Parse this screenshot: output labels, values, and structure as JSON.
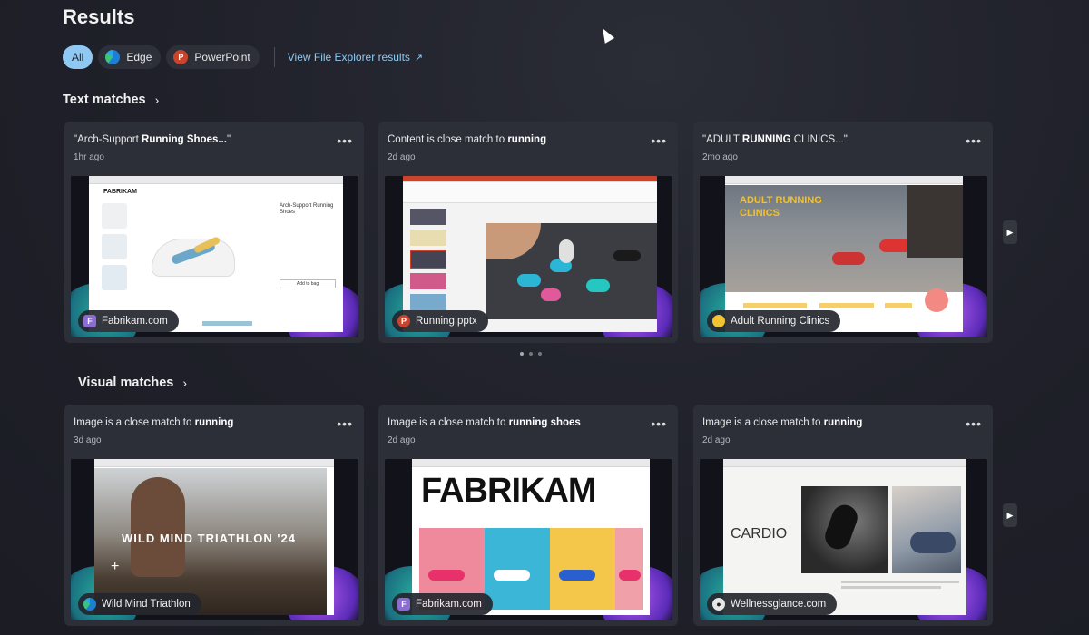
{
  "page": {
    "title": "Results"
  },
  "filters": {
    "chips": [
      {
        "label": "All",
        "active": true
      },
      {
        "label": "Edge",
        "icon": "edge-icon"
      },
      {
        "label": "PowerPoint",
        "icon": "powerpoint-icon"
      }
    ],
    "file_explorer_link": "View File Explorer results"
  },
  "text_matches": {
    "header": "Text matches",
    "cards": [
      {
        "title_pre": "\"Arch-Support ",
        "title_bold": "Running Shoes...",
        "title_post": "\"",
        "time": "1hr ago",
        "source": "Fabrikam.com",
        "source_icon": "F"
      },
      {
        "title_pre": "Content is close match to ",
        "title_bold": "running",
        "title_post": "",
        "time": "2d ago",
        "source": "Running.pptx",
        "source_icon": "P"
      },
      {
        "title_pre": "\"ADULT ",
        "title_bold": "RUNNING",
        "title_post": " CLINICS...\"",
        "time": "2mo ago",
        "source": "Adult Running Clinics",
        "source_icon": "circle"
      }
    ]
  },
  "visual_matches": {
    "header": "Visual matches",
    "cards": [
      {
        "title_pre": "Image is a close match to ",
        "title_bold": "running",
        "title_post": "",
        "time": "3d ago",
        "source": "Wild Mind Triathlon",
        "source_icon": "edge"
      },
      {
        "title_pre": "Image is a close match to ",
        "title_bold": "running shoes",
        "title_post": "",
        "time": "2d ago",
        "source": "Fabrikam.com",
        "source_icon": "F"
      },
      {
        "title_pre": "Image is a close match to ",
        "title_bold": "running",
        "title_post": "",
        "time": "2d ago",
        "source": "Wellnessglance.com",
        "source_icon": "drop"
      }
    ]
  },
  "thumb_text": {
    "fabrikam_brand": "FABRIKAM",
    "arch_support": "Arch-Support Running Shoes",
    "add_to_bag": "Add to bag",
    "adult_running": "ADULT RUNNING CLINICS",
    "triathlon": "WILD MIND TRIATHLON '24",
    "fabrikam_big": "FABRIKAM",
    "cardio": "CARDIO"
  },
  "colors": {
    "accent": "#8fc8f2",
    "link": "#8ccaf4",
    "card_bg": "#2c2e38"
  }
}
